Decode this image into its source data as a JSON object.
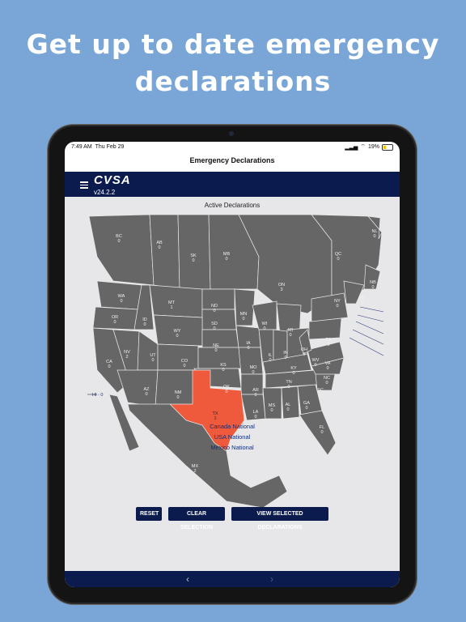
{
  "headline": "Get up to date emergency declarations",
  "status": {
    "time": "7:49 AM",
    "date": "Thu Feb 29",
    "battery": "19%"
  },
  "nav_title": "Emergency Declarations",
  "app": {
    "logo": "CVSA",
    "version": "v24.2.2"
  },
  "map": {
    "title": "Active Declarations",
    "selected_state": "TX",
    "selected_color": "#f05a3c",
    "region_color": "#666666",
    "hawaii": "HI - 0",
    "states": [
      {
        "abbr": "BC",
        "count": "0"
      },
      {
        "abbr": "AB",
        "count": "0"
      },
      {
        "abbr": "SK",
        "count": "0"
      },
      {
        "abbr": "MB",
        "count": "0"
      },
      {
        "abbr": "ON",
        "count": "3"
      },
      {
        "abbr": "QC",
        "count": "0"
      },
      {
        "abbr": "NL",
        "count": "0"
      },
      {
        "abbr": "NB",
        "count": "0"
      },
      {
        "abbr": "WA",
        "count": "0"
      },
      {
        "abbr": "OR",
        "count": "0"
      },
      {
        "abbr": "ID",
        "count": "0"
      },
      {
        "abbr": "MT",
        "count": "1"
      },
      {
        "abbr": "ND",
        "count": "0"
      },
      {
        "abbr": "MN",
        "count": "0"
      },
      {
        "abbr": "SD",
        "count": "0"
      },
      {
        "abbr": "WY",
        "count": "0"
      },
      {
        "abbr": "NV",
        "count": "2"
      },
      {
        "abbr": "UT",
        "count": "0"
      },
      {
        "abbr": "CA",
        "count": "0"
      },
      {
        "abbr": "CO",
        "count": "0"
      },
      {
        "abbr": "NE",
        "count": "0"
      },
      {
        "abbr": "IA",
        "count": "0"
      },
      {
        "abbr": "WI",
        "count": "0"
      },
      {
        "abbr": "MI",
        "count": "0"
      },
      {
        "abbr": "IL",
        "count": "0"
      },
      {
        "abbr": "IN",
        "count": "0"
      },
      {
        "abbr": "OH",
        "count": "0"
      },
      {
        "abbr": "PA",
        "count": "0"
      },
      {
        "abbr": "NY",
        "count": "0"
      },
      {
        "abbr": "ME",
        "count": "0"
      },
      {
        "abbr": "KS",
        "count": "0"
      },
      {
        "abbr": "MO",
        "count": "0"
      },
      {
        "abbr": "KY",
        "count": "0"
      },
      {
        "abbr": "WV",
        "count": "0"
      },
      {
        "abbr": "VA",
        "count": "0"
      },
      {
        "abbr": "AZ",
        "count": "0"
      },
      {
        "abbr": "NM",
        "count": "0"
      },
      {
        "abbr": "OK",
        "count": "0"
      },
      {
        "abbr": "AR",
        "count": "0"
      },
      {
        "abbr": "TN",
        "count": "0"
      },
      {
        "abbr": "NC",
        "count": "0"
      },
      {
        "abbr": "SC",
        "count": "0"
      },
      {
        "abbr": "TX",
        "count": "1"
      },
      {
        "abbr": "LA",
        "count": "0"
      },
      {
        "abbr": "MS",
        "count": "0"
      },
      {
        "abbr": "AL",
        "count": "0"
      },
      {
        "abbr": "GA",
        "count": "0"
      },
      {
        "abbr": "FL",
        "count": "0"
      },
      {
        "abbr": "MX",
        "count": "2"
      }
    ],
    "national": [
      "Canada National",
      "USA National",
      "Mexico National"
    ]
  },
  "buttons": {
    "reset": "RESET",
    "clear": "CLEAR SELECTION",
    "view": "VIEW SELECTED DECLARATIONS"
  },
  "colors": {
    "background": "#7aa6d7",
    "navy": "#0b1b4d",
    "accent": "#f05a3c"
  }
}
